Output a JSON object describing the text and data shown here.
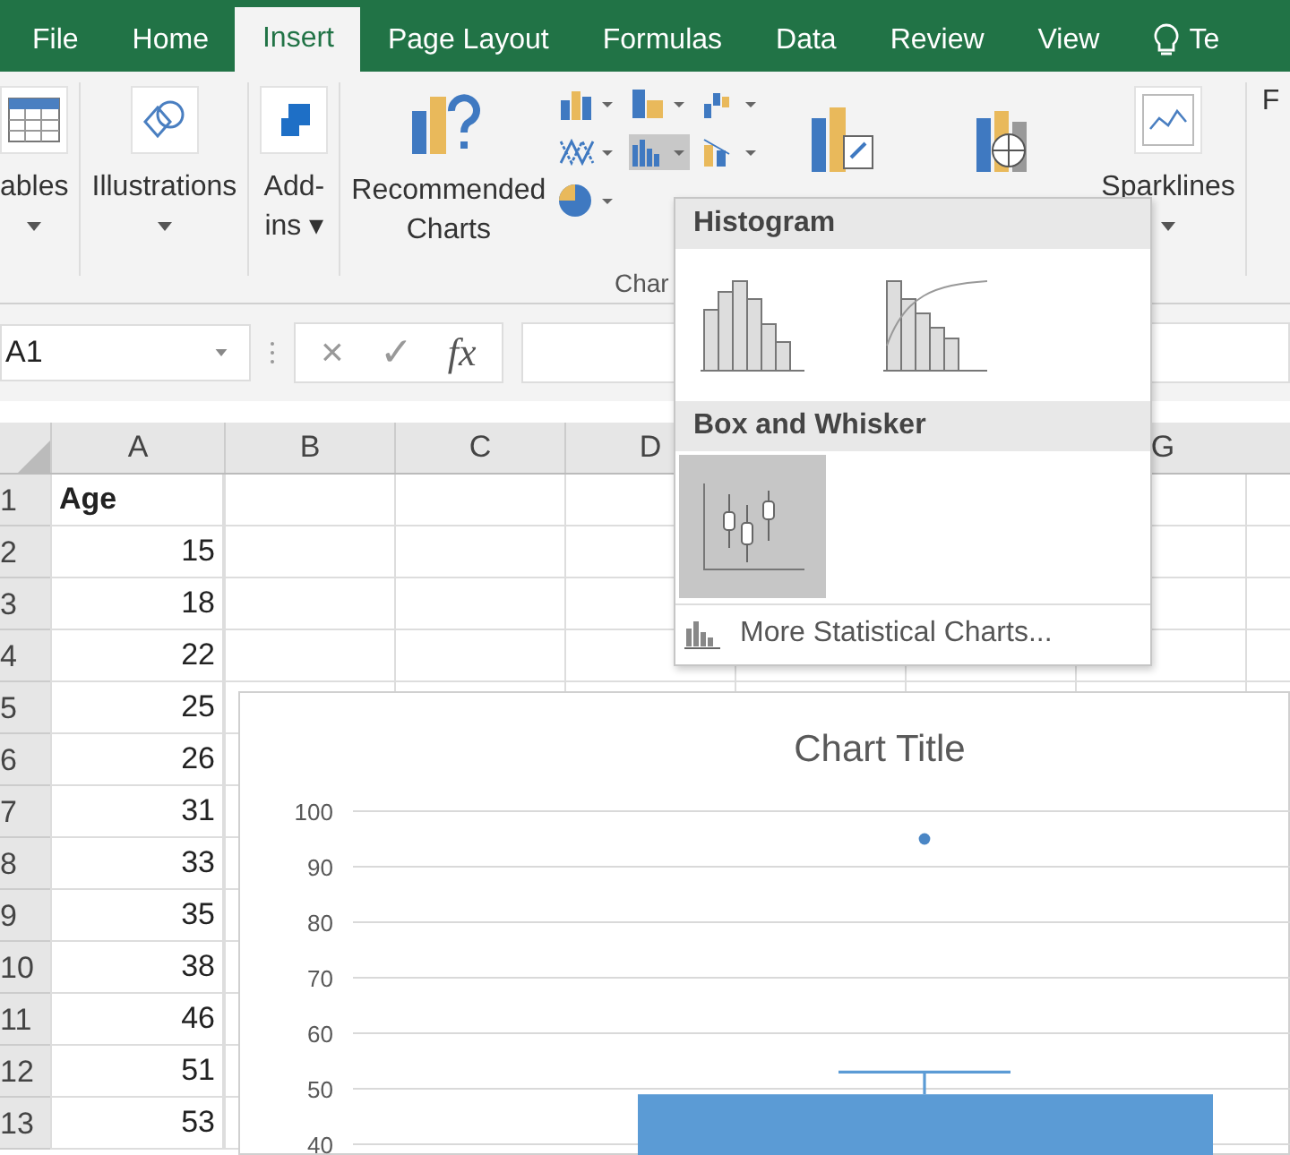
{
  "tabs": [
    {
      "label": "File",
      "selected": false
    },
    {
      "label": "Home",
      "selected": false
    },
    {
      "label": "Insert",
      "selected": true
    },
    {
      "label": "Page Layout",
      "selected": false
    },
    {
      "label": "Formulas",
      "selected": false
    },
    {
      "label": "Data",
      "selected": false
    },
    {
      "label": "Review",
      "selected": false
    },
    {
      "label": "View",
      "selected": false
    },
    {
      "label": "Te",
      "selected": false,
      "kind": "tell"
    }
  ],
  "ribbon": {
    "buttons": [
      {
        "kind": "tables",
        "lines": [
          "ables"
        ],
        "caret": true
      },
      {
        "kind": "illustrations",
        "lines": [
          "Illustrations"
        ],
        "caret": true
      },
      {
        "kind": "addins",
        "lines": [
          "Add-",
          "ins ▾"
        ],
        "caret": false
      },
      {
        "kind": "recommended",
        "lines": [
          "Recommended",
          "Charts"
        ],
        "caret": false
      }
    ],
    "more_buttons": [
      {
        "kind": "sparklines",
        "lines": [
          "Sparklines"
        ],
        "caret": true
      },
      {
        "kind": "next",
        "lines": [
          "F"
        ],
        "caret": false
      }
    ],
    "group_label": "Char"
  },
  "formula_bar": {
    "name_box": "A1",
    "cancel": "×",
    "enter": "✓",
    "function": "fx"
  },
  "sheet": {
    "columns": [
      "A",
      "B",
      "C",
      "D",
      "G"
    ],
    "rows": [
      {
        "num": "1",
        "value": "Age",
        "kind": "label"
      },
      {
        "num": "2",
        "value": "15",
        "kind": "number"
      },
      {
        "num": "3",
        "value": "18",
        "kind": "number"
      },
      {
        "num": "4",
        "value": "22",
        "kind": "number"
      },
      {
        "num": "5",
        "value": "25",
        "kind": "number"
      },
      {
        "num": "6",
        "value": "26",
        "kind": "number"
      },
      {
        "num": "7",
        "value": "31",
        "kind": "number"
      },
      {
        "num": "8",
        "value": "33",
        "kind": "number"
      },
      {
        "num": "9",
        "value": "35",
        "kind": "number"
      },
      {
        "num": "10",
        "value": "38",
        "kind": "number"
      },
      {
        "num": "11",
        "value": "46",
        "kind": "number"
      },
      {
        "num": "12",
        "value": "51",
        "kind": "number"
      },
      {
        "num": "13",
        "value": "53",
        "kind": "number"
      }
    ]
  },
  "dropdown": {
    "sections": [
      {
        "title": "Histogram",
        "items": [
          {
            "kind": "histogram",
            "selected": false
          },
          {
            "kind": "pareto",
            "selected": false
          }
        ]
      },
      {
        "title": "Box and Whisker",
        "items": [
          {
            "kind": "boxwhisker",
            "selected": true
          }
        ]
      }
    ],
    "more_link": "More Statistical Charts..."
  },
  "chart": {
    "chart_data": {
      "type": "bar",
      "title": "Chart Title",
      "ylim": [
        40,
        100
      ],
      "yticks": [
        40,
        50,
        60,
        70,
        80,
        90,
        100
      ],
      "grid": true,
      "series": [
        {
          "color": "#5b9bd5",
          "values": [
            49
          ]
        }
      ]
    }
  }
}
